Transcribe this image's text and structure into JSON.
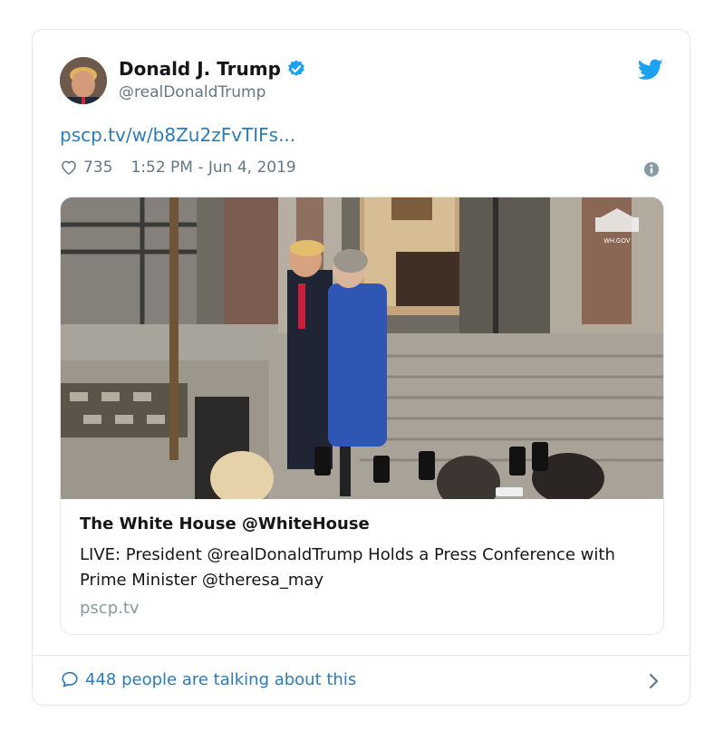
{
  "tweet": {
    "author_name": "Donald J. Trump",
    "author_handle": "@realDonaldTrump",
    "link_text": "pscp.tv/w/b8Zu2zFvTIFs...",
    "likes": "735",
    "timestamp": "1:52 PM - Jun 4, 2019"
  },
  "card": {
    "title": "The White House @WhiteHouse",
    "description": "LIVE: President @realDonaldTrump Holds a Press Conference with Prime Minister @theresa_may",
    "domain": "pscp.tv",
    "watermark": "WH.GOV"
  },
  "footer": {
    "talking_text": "448 people are talking about this"
  },
  "colors": {
    "link": "#2b7bb9",
    "muted": "#657786",
    "verified": "#1da1f2",
    "twitter_blue": "#1da1f2"
  },
  "icons": [
    "verified-badge-icon",
    "twitter-bird-icon",
    "heart-icon",
    "info-icon",
    "speech-bubble-icon",
    "chevron-right-icon"
  ]
}
